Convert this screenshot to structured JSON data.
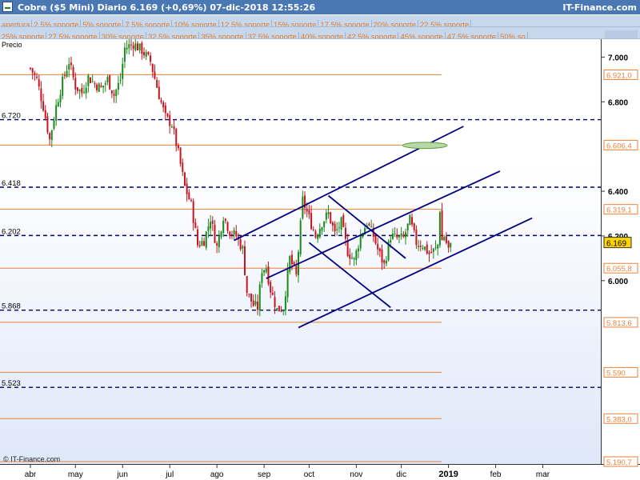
{
  "header": {
    "title": "Cobre ($5 Mini)    Diario    6.169 (+0,69%)    07-dic-2018 12:55:26",
    "brand": "IT-Finance.com"
  },
  "toolbar": {
    "row1": [
      "apertura",
      "2.5% soporte",
      "5% soporte",
      "7.5% soporte",
      "10% soporte",
      "12.5% soporte",
      "15% soporte",
      "17.5% soporte",
      "20% soporte",
      "22.5% soporte"
    ],
    "row2": [
      "25% soporte",
      "27.5% soporte",
      "30% soporte",
      "32.5% soporte",
      "35% soporte",
      "37.5% soporte",
      "40% soporte",
      "42.5% soporte",
      "45% soporte",
      "47.5% soporte",
      "50% so"
    ]
  },
  "chart": {
    "price_label": "Precio",
    "copyright": "© IT-Finance.com"
  },
  "colors": {
    "up": "#1a8a1a",
    "down": "#c8141e",
    "support_line": "#e8823a",
    "level_line": "#00006e",
    "channel": "#000080",
    "ellipse": "#5a9a3a",
    "current_price_bg": "#ffd400"
  },
  "chart_data": {
    "type": "candlestick",
    "symbol": "Cobre ($5 Mini)",
    "period": "Diario",
    "last_price": "6.169",
    "change": "+0,69%",
    "ylim": [
      5.18,
      7.08
    ],
    "y_ticks": [
      {
        "value": 7.0,
        "label": "7.000"
      },
      {
        "value": 6.8,
        "label": "6.800"
      },
      {
        "value": 6.4,
        "label": "6.400"
      },
      {
        "value": 6.2,
        "label": "6.200"
      },
      {
        "value": 6.0,
        "label": "6.000"
      }
    ],
    "x_ticks": [
      {
        "day": 0,
        "label": "abr"
      },
      {
        "day": 21,
        "label": "may"
      },
      {
        "day": 43,
        "label": "jun"
      },
      {
        "day": 65,
        "label": "jul"
      },
      {
        "day": 87,
        "label": "ago"
      },
      {
        "day": 109,
        "label": "sep"
      },
      {
        "day": 130,
        "label": "oct"
      },
      {
        "day": 152,
        "label": "nov"
      },
      {
        "day": 173,
        "label": "dic"
      },
      {
        "day": 195,
        "label": "2019"
      },
      {
        "day": 217,
        "label": "feb"
      },
      {
        "day": 239,
        "label": "mar"
      }
    ],
    "support_levels": [
      {
        "value": 6.921,
        "label": "6.921,0"
      },
      {
        "value": 6.6064,
        "label": "6.606,4"
      },
      {
        "value": 6.3191,
        "label": "6.319,1"
      },
      {
        "value": 6.0558,
        "label": "6.055,8"
      },
      {
        "value": 5.8136,
        "label": "5.813,6"
      },
      {
        "value": 5.59,
        "label": "5.590"
      },
      {
        "value": 5.383,
        "label": "5.383,0"
      },
      {
        "value": 5.1907,
        "label": "5.190,7"
      }
    ],
    "pivot_levels": [
      {
        "value": 6.72,
        "label": "6.720"
      },
      {
        "value": 6.418,
        "label": "6.418"
      },
      {
        "value": 6.202,
        "label": "6.202"
      },
      {
        "value": 5.868,
        "label": "5.868"
      },
      {
        "value": 5.523,
        "label": "5.523"
      }
    ],
    "current_price_label": "6.169",
    "trendlines": [
      {
        "from": [
          95,
          6.18
        ],
        "to": [
          202,
          6.69
        ]
      },
      {
        "from": [
          110,
          6.01
        ],
        "to": [
          219,
          6.49
        ]
      },
      {
        "from": [
          125,
          5.79
        ],
        "to": [
          234,
          6.28
        ]
      },
      {
        "from": [
          139,
          6.38
        ],
        "to": [
          175,
          6.1
        ]
      },
      {
        "from": [
          130,
          6.17
        ],
        "to": [
          168,
          5.88
        ]
      }
    ],
    "ellipse": {
      "center": [
        184,
        6.605
      ],
      "width_days": 9,
      "height": 0.014
    },
    "close_path": [
      [
        0,
        6.95
      ],
      [
        3,
        6.9
      ],
      [
        6,
        6.78
      ],
      [
        9,
        6.63
      ],
      [
        12,
        6.78
      ],
      [
        15,
        6.89
      ],
      [
        18,
        6.98
      ],
      [
        21,
        6.87
      ],
      [
        24,
        6.84
      ],
      [
        27,
        6.91
      ],
      [
        30,
        6.88
      ],
      [
        33,
        6.86
      ],
      [
        36,
        6.9
      ],
      [
        39,
        6.83
      ],
      [
        42,
        6.9
      ],
      [
        44,
        7.04
      ],
      [
        48,
        7.06
      ],
      [
        52,
        7.03
      ],
      [
        56,
        6.98
      ],
      [
        60,
        6.83
      ],
      [
        63,
        6.73
      ],
      [
        66,
        6.7
      ],
      [
        69,
        6.57
      ],
      [
        72,
        6.42
      ],
      [
        75,
        6.34
      ],
      [
        78,
        6.16
      ],
      [
        81,
        6.18
      ],
      [
        84,
        6.28
      ],
      [
        87,
        6.15
      ],
      [
        90,
        6.29
      ],
      [
        93,
        6.22
      ],
      [
        96,
        6.2
      ],
      [
        99,
        6.14
      ],
      [
        101,
        5.95
      ],
      [
        104,
        5.89
      ],
      [
        106,
        5.88
      ],
      [
        108,
        6.05
      ],
      [
        110,
        6.06
      ],
      [
        112,
        5.96
      ],
      [
        115,
        5.87
      ],
      [
        118,
        5.88
      ],
      [
        121,
        6.1
      ],
      [
        124,
        6.02
      ],
      [
        127,
        6.36
      ],
      [
        130,
        6.28
      ],
      [
        133,
        6.2
      ],
      [
        136,
        6.26
      ],
      [
        139,
        6.3
      ],
      [
        142,
        6.21
      ],
      [
        145,
        6.26
      ],
      [
        148,
        6.13
      ],
      [
        151,
        6.09
      ],
      [
        154,
        6.2
      ],
      [
        157,
        6.26
      ],
      [
        160,
        6.2
      ],
      [
        162,
        6.14
      ],
      [
        165,
        6.07
      ],
      [
        168,
        6.2
      ],
      [
        171,
        6.19
      ],
      [
        174,
        6.19
      ],
      [
        177,
        6.27
      ],
      [
        180,
        6.17
      ],
      [
        183,
        6.16
      ],
      [
        186,
        6.12
      ],
      [
        189,
        6.14
      ],
      [
        190,
        6.16
      ],
      [
        191,
        6.32
      ],
      [
        192,
        6.18
      ],
      [
        193,
        6.2
      ],
      [
        194,
        6.17
      ],
      [
        195,
        6.14
      ],
      [
        196,
        6.169
      ]
    ]
  }
}
